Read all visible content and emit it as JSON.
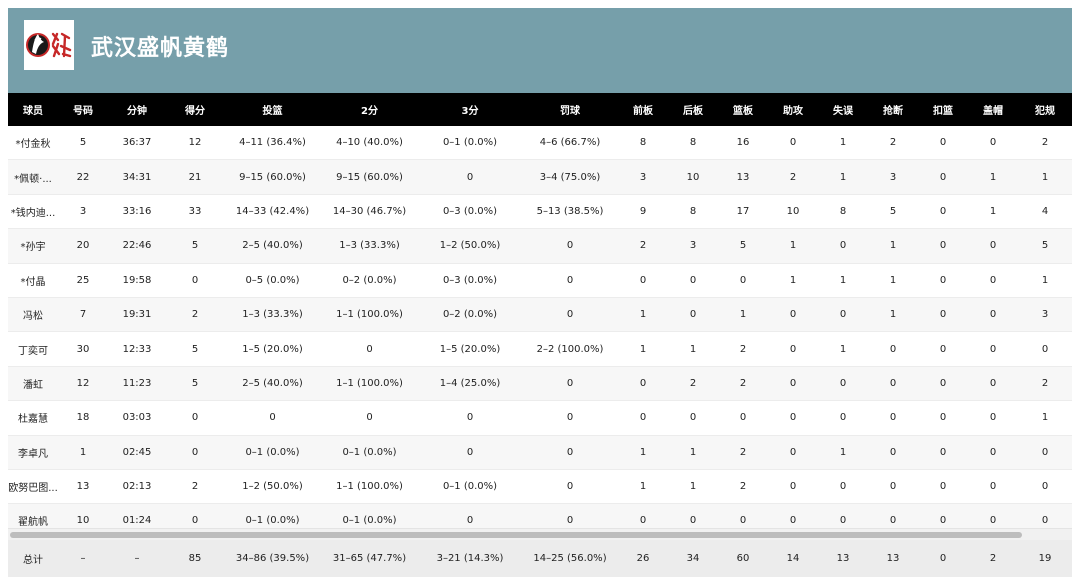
{
  "team": {
    "name": "武汉盛帆黄鹤",
    "logo_icon": "crane-logo-icon",
    "header_color": "#769faa"
  },
  "columns": [
    "球员",
    "号码",
    "分钟",
    "得分",
    "投篮",
    "2分",
    "3分",
    "罚球",
    "前板",
    "后板",
    "篮板",
    "助攻",
    "失误",
    "抢断",
    "扣篮",
    "盖帽",
    "犯规"
  ],
  "rows": [
    [
      "*付金秋",
      "5",
      "36:37",
      "12",
      "4–11 (36.4%)",
      "4–10 (40.0%)",
      "0–1 (0.0%)",
      "4–6 (66.7%)",
      "8",
      "8",
      "16",
      "0",
      "1",
      "2",
      "0",
      "0",
      "2"
    ],
    [
      "*佩顿·...",
      "22",
      "34:31",
      "21",
      "9–15 (60.0%)",
      "9–15 (60.0%)",
      "0",
      "3–4 (75.0%)",
      "3",
      "10",
      "13",
      "2",
      "1",
      "3",
      "0",
      "1",
      "1"
    ],
    [
      "*钱内迪...",
      "3",
      "33:16",
      "33",
      "14–33 (42.4%)",
      "14–30 (46.7%)",
      "0–3 (0.0%)",
      "5–13 (38.5%)",
      "9",
      "8",
      "17",
      "10",
      "8",
      "5",
      "0",
      "1",
      "4"
    ],
    [
      "*孙宇",
      "20",
      "22:46",
      "5",
      "2–5 (40.0%)",
      "1–3 (33.3%)",
      "1–2 (50.0%)",
      "0",
      "2",
      "3",
      "5",
      "1",
      "0",
      "1",
      "0",
      "0",
      "5"
    ],
    [
      "*付晶",
      "25",
      "19:58",
      "0",
      "0–5 (0.0%)",
      "0–2 (0.0%)",
      "0–3 (0.0%)",
      "0",
      "0",
      "0",
      "0",
      "1",
      "1",
      "1",
      "0",
      "0",
      "1"
    ],
    [
      "冯松",
      "7",
      "19:31",
      "2",
      "1–3 (33.3%)",
      "1–1 (100.0%)",
      "0–2 (0.0%)",
      "0",
      "1",
      "0",
      "1",
      "0",
      "0",
      "1",
      "0",
      "0",
      "3"
    ],
    [
      "丁奕可",
      "30",
      "12:33",
      "5",
      "1–5 (20.0%)",
      "0",
      "1–5 (20.0%)",
      "2–2 (100.0%)",
      "1",
      "1",
      "2",
      "0",
      "1",
      "0",
      "0",
      "0",
      "0"
    ],
    [
      "潘虹",
      "12",
      "11:23",
      "5",
      "2–5 (40.0%)",
      "1–1 (100.0%)",
      "1–4 (25.0%)",
      "0",
      "0",
      "2",
      "2",
      "0",
      "0",
      "0",
      "0",
      "0",
      "2"
    ],
    [
      "杜嘉慧",
      "18",
      "03:03",
      "0",
      "0",
      "0",
      "0",
      "0",
      "0",
      "0",
      "0",
      "0",
      "0",
      "0",
      "0",
      "0",
      "1"
    ],
    [
      "李卓凡",
      "1",
      "02:45",
      "0",
      "0–1 (0.0%)",
      "0–1 (0.0%)",
      "0",
      "0",
      "1",
      "1",
      "2",
      "0",
      "1",
      "0",
      "0",
      "0",
      "0"
    ],
    [
      "欧努巴图...",
      "13",
      "02:13",
      "2",
      "1–2 (50.0%)",
      "1–1 (100.0%)",
      "0–1 (0.0%)",
      "0",
      "1",
      "1",
      "2",
      "0",
      "0",
      "0",
      "0",
      "0",
      "0"
    ],
    [
      "翟航帆",
      "10",
      "01:24",
      "0",
      "0–1 (0.0%)",
      "0–1 (0.0%)",
      "0",
      "0",
      "0",
      "0",
      "0",
      "0",
      "0",
      "0",
      "0",
      "0",
      "0"
    ]
  ],
  "totals": [
    "总计",
    "–",
    "–",
    "85",
    "34–86 (39.5%)",
    "31–65 (47.7%)",
    "3–21 (14.3%)",
    "14–25 (56.0%)",
    "26",
    "34",
    "60",
    "14",
    "13",
    "13",
    "0",
    "2",
    "19"
  ],
  "colors": {
    "header_bg": "#000000",
    "row_alt": "#f7f7f7",
    "totals_bg": "#ececec"
  }
}
